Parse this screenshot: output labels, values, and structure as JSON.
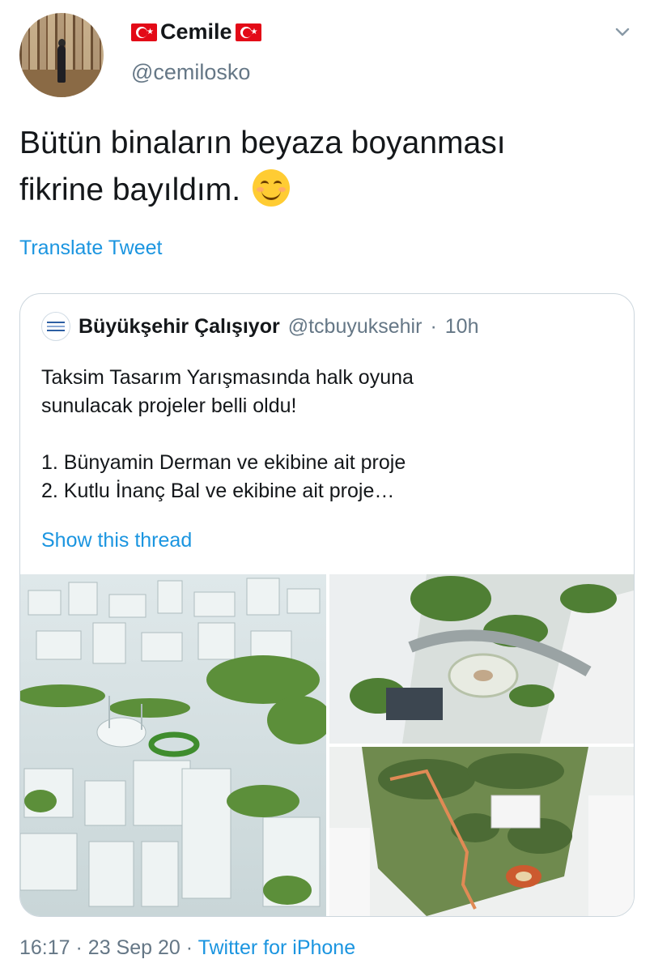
{
  "author": {
    "display_name": "Cemile",
    "handle": "@cemilosko",
    "flag_left_icon": "turkey-flag-icon",
    "flag_right_icon": "turkey-flag-icon"
  },
  "tweet": {
    "line1": "Bütün binaların beyaza boyanması",
    "line2": "fikrine bayıldım.",
    "emoji_icon": "smiling-face-with-smiling-eyes-icon",
    "translate_label": "Translate Tweet"
  },
  "quoted_tweet": {
    "name": "Büyükşehir Çalışıyor",
    "handle": "@tcbuyuksehir",
    "separator": "·",
    "time": "10h",
    "lines": [
      "Taksim Tasarım Yarışmasında halk oyuna",
      "sunulacak projeler belli oldu!",
      "",
      "1. Bünyamin Derman ve ekibine ait proje",
      "2. Kutlu İnanç Bal ve ekibine ait proje…"
    ],
    "show_thread_label": "Show this thread",
    "images": [
      "aerial-render-white-buildings",
      "aerial-render-square-plaza",
      "aerial-render-park-walkway"
    ]
  },
  "footer": {
    "time": "16:17",
    "sep1": "·",
    "date": "23 Sep 20",
    "sep2": "·",
    "source": "Twitter for iPhone"
  },
  "colors": {
    "link": "#1b95e0",
    "secondary_text": "#657786",
    "border": "#ccd6dd"
  }
}
